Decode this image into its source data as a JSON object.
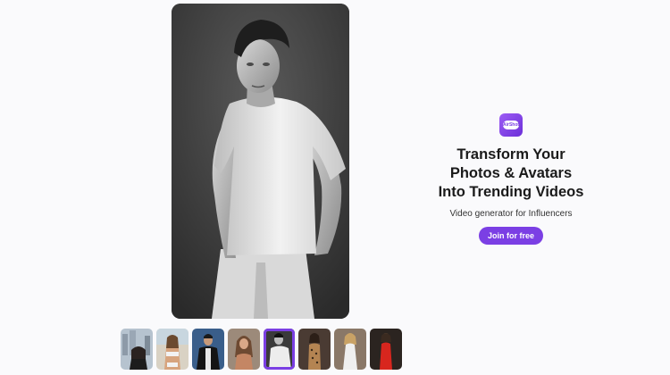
{
  "hero": {
    "image_icon": "man-white-tshirt-photo"
  },
  "thumbnails": [
    {
      "icon": "woman-city-photo",
      "selected": false
    },
    {
      "icon": "woman-beach-photo",
      "selected": false
    },
    {
      "icon": "man-black-jacket-photo",
      "selected": false
    },
    {
      "icon": "woman-portrait-photo",
      "selected": false
    },
    {
      "icon": "man-white-tshirt-photo",
      "selected": true
    },
    {
      "icon": "woman-leopard-dress-photo",
      "selected": false
    },
    {
      "icon": "woman-white-dress-photo",
      "selected": false
    },
    {
      "icon": "woman-red-dress-photo",
      "selected": false
    }
  ],
  "promo": {
    "logo_text": "AirShot",
    "headline_1": "Transform Your",
    "headline_2": "Photos & Avatars",
    "headline_3": "Into Trending Videos",
    "subtitle": "Video generator for Influencers",
    "cta_label": "Join for free"
  },
  "colors": {
    "accent": "#7b3fe4",
    "background": "#fafafc",
    "text": "#1a1a1a"
  }
}
